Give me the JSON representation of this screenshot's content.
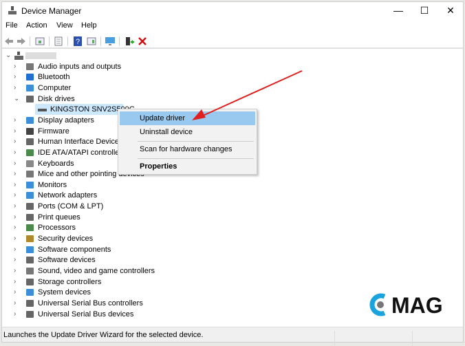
{
  "window": {
    "title": "Device Manager",
    "minimize": "—",
    "maximize": "☐",
    "close": "✕"
  },
  "menu": [
    "File",
    "Action",
    "View",
    "Help"
  ],
  "toolbar": {
    "icons": [
      "back-icon",
      "forward-icon",
      "properties-pane-icon",
      "details-icon",
      "help-icon",
      "view-icon",
      "monitor-scan-icon",
      "add-driver-icon",
      "remove-icon"
    ]
  },
  "tree": {
    "root": "",
    "items": [
      {
        "label": "Audio inputs and outputs",
        "icon": "speaker-icon",
        "color": "#777"
      },
      {
        "label": "Bluetooth",
        "icon": "bluetooth-icon",
        "color": "#1e6fd0"
      },
      {
        "label": "Computer",
        "icon": "computer-icon",
        "color": "#3a8fd8"
      },
      {
        "label": "Disk drives",
        "icon": "disk-icon",
        "color": "#666",
        "expanded": true,
        "children": [
          {
            "label": "KINGSTON SNV2S500G",
            "icon": "disk-icon",
            "selected": true
          }
        ]
      },
      {
        "label": "Display adapters",
        "icon": "display-adapter-icon",
        "color": "#3a8fd8"
      },
      {
        "label": "Firmware",
        "icon": "firmware-icon",
        "color": "#444"
      },
      {
        "label": "Human Interface Devices",
        "icon": "hid-icon",
        "color": "#666"
      },
      {
        "label": "IDE ATA/ATAPI controllers",
        "icon": "ide-icon",
        "color": "#4a8a4a"
      },
      {
        "label": "Keyboards",
        "icon": "keyboard-icon",
        "color": "#888"
      },
      {
        "label": "Mice and other pointing devices",
        "icon": "mouse-icon",
        "color": "#777"
      },
      {
        "label": "Monitors",
        "icon": "monitor-icon",
        "color": "#3a8fd8"
      },
      {
        "label": "Network adapters",
        "icon": "network-icon",
        "color": "#3a8fd8"
      },
      {
        "label": "Ports (COM & LPT)",
        "icon": "port-icon",
        "color": "#666"
      },
      {
        "label": "Print queues",
        "icon": "printer-icon",
        "color": "#666"
      },
      {
        "label": "Processors",
        "icon": "processor-icon",
        "color": "#4a8a4a"
      },
      {
        "label": "Security devices",
        "icon": "security-icon",
        "color": "#b08a2a"
      },
      {
        "label": "Software components",
        "icon": "software-component-icon",
        "color": "#3a8fd8"
      },
      {
        "label": "Software devices",
        "icon": "software-device-icon",
        "color": "#666"
      },
      {
        "label": "Sound, video and game controllers",
        "icon": "sound-icon",
        "color": "#777"
      },
      {
        "label": "Storage controllers",
        "icon": "storage-icon",
        "color": "#666"
      },
      {
        "label": "System devices",
        "icon": "system-icon",
        "color": "#3a8fd8"
      },
      {
        "label": "Universal Serial Bus controllers",
        "icon": "usb-icon",
        "color": "#666"
      },
      {
        "label": "Universal Serial Bus devices",
        "icon": "usb-icon",
        "color": "#666"
      }
    ]
  },
  "context_menu": [
    {
      "label": "Update driver",
      "highlighted": true
    },
    {
      "label": "Uninstall device"
    },
    {
      "label": "Scan for hardware changes"
    },
    {
      "label": "Properties",
      "bold": true
    }
  ],
  "status_bar": "Launches the Update Driver Wizard for the selected device.",
  "annotation": {
    "arrow_color": "#e02020"
  },
  "watermark": {
    "text": "CMAG",
    "accent": "#1aa3dd"
  }
}
